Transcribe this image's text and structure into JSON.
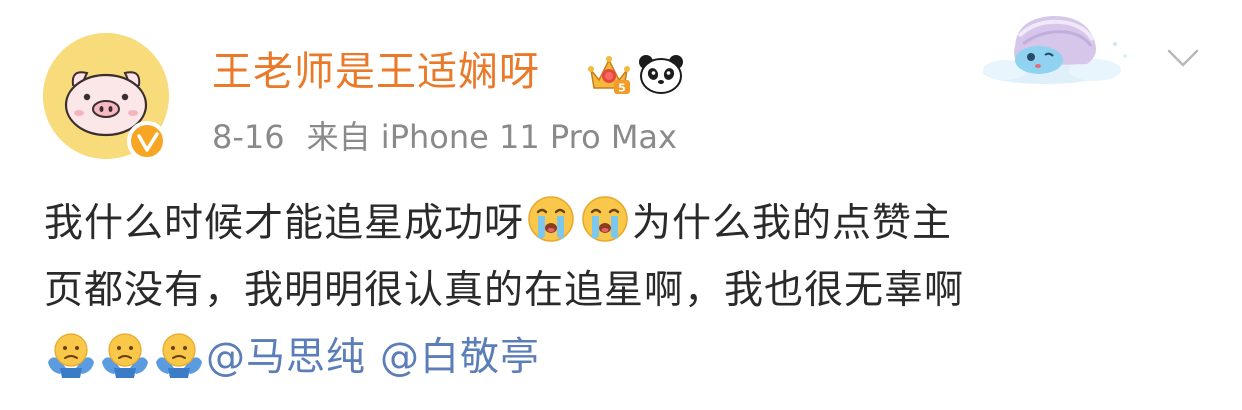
{
  "post": {
    "username": "王老师是王适娴呀",
    "meta": {
      "date": "8-16",
      "source": "来自 iPhone 11 Pro Max"
    },
    "badges": {
      "crown_level": "5"
    },
    "content": {
      "line1_text_a": "我什么时候才能追星成功呀",
      "line1_text_b": "为什么我的点赞主",
      "line2_text": "页都没有，我明明很认真的在追星啊，我也很无辜啊",
      "mention1": "@马思纯",
      "mention2": "@白敬亭"
    },
    "colors": {
      "username": "#ea7a2a",
      "meta": "#8a8a8a",
      "text": "#2a2a2a",
      "mention": "#5b7db8",
      "avatar_bg": "#f8dc7c",
      "verified": "#f6a623"
    },
    "icons": {
      "avatar": "pig-face-avatar",
      "verified": "verified-check-icon",
      "crown": "crown-level-icon",
      "panda": "panda-icon",
      "cry": "crying-emoji-icon",
      "shrug": "shrug-emoji-icon",
      "more": "chevron-down-icon"
    }
  }
}
